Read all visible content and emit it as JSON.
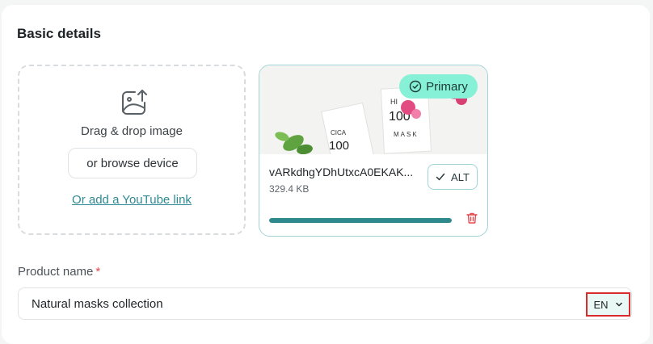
{
  "section": {
    "title": "Basic details"
  },
  "dropzone": {
    "drag_text": "Drag & drop image",
    "browse_label": "or browse device",
    "youtube_link": "Or add a YouTube link"
  },
  "image": {
    "badge": "Primary",
    "file_name": "vARkdhgYDhUtxcA0EKAK...",
    "file_size": "329.4 KB",
    "alt_label": "ALT",
    "upload_progress": 1.0,
    "thumb_text": {
      "hi": "HI",
      "cica": "CICA",
      "nums": "100",
      "mask": "MASK"
    }
  },
  "product_name": {
    "label": "Product name",
    "required_mark": "*",
    "value": "Natural masks collection",
    "lang": "EN"
  },
  "colors": {
    "accent": "#2f8a8e",
    "badge": "#86f1d6",
    "required": "#e5484d",
    "highlight": "#d92b2b"
  },
  "icons": {
    "upload": "image-upload-icon",
    "primary": "check-circle-icon",
    "alt": "check-icon",
    "delete": "trash-icon",
    "lang": "chevron-down-icon"
  }
}
